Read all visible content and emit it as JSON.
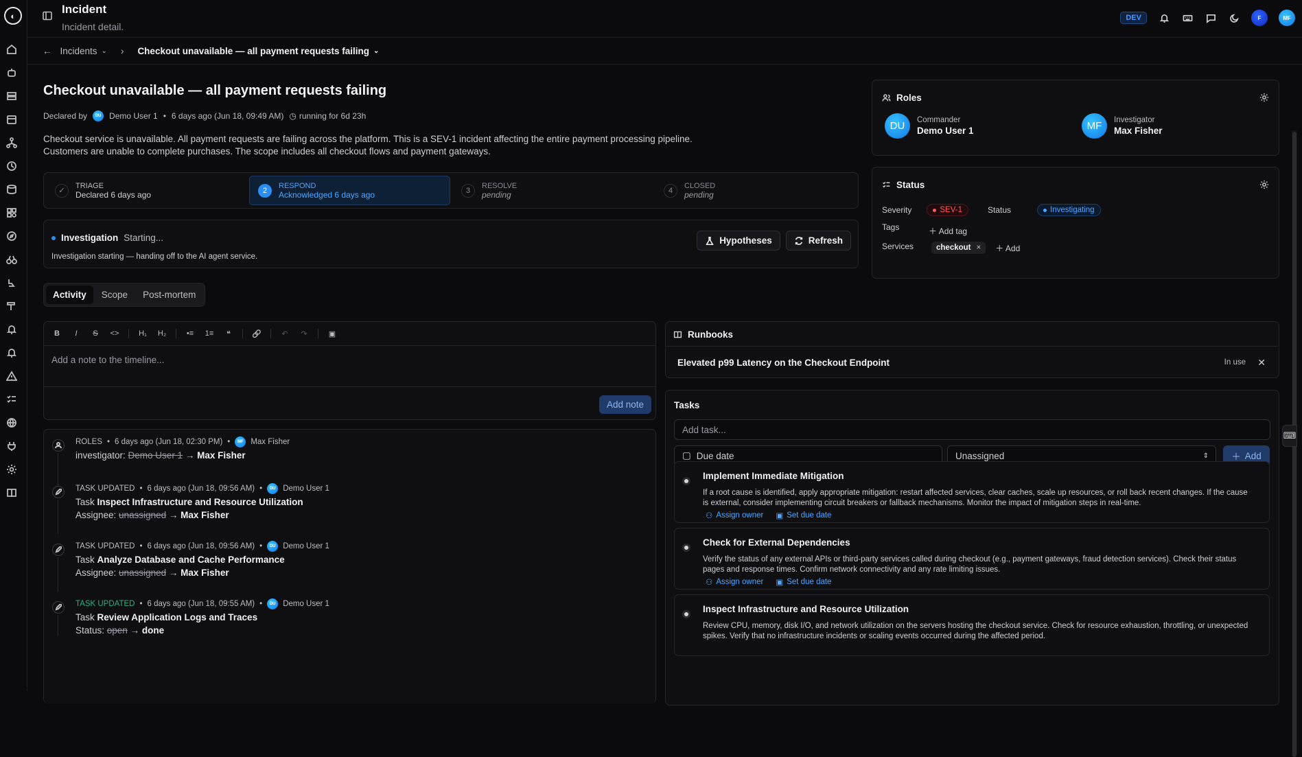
{
  "header": {
    "title": "Incident",
    "subtitle": "Incident detail.",
    "env_badge": "DEV",
    "avatar1": "F",
    "avatar2": "MF"
  },
  "breadcrumb": {
    "parent": "Incidents",
    "current": "Checkout unavailable — all payment requests failing"
  },
  "incident": {
    "title": "Checkout unavailable — all payment requests failing",
    "declared_by_label": "Declared by",
    "declared_by_initials": "DU",
    "declared_by_name": "Demo User 1",
    "declared_when": "6 days ago (Jun 18, 09:49 AM)",
    "running_for": "running for 6d 23h",
    "description": "Checkout service is unavailable. All payment requests are failing across the platform. This is a SEV-1 incident affecting the entire payment processing pipeline. Customers are unable to complete purchases. The scope includes all checkout flows and payment gateways."
  },
  "stages": [
    {
      "num": "✓",
      "name": "TRIAGE",
      "detail": "Declared 6 days ago",
      "state": "done"
    },
    {
      "num": "2",
      "name": "RESPOND",
      "detail": "Acknowledged 6 days ago",
      "state": "active"
    },
    {
      "num": "3",
      "name": "RESOLVE",
      "detail": "pending",
      "state": "pending"
    },
    {
      "num": "4",
      "name": "CLOSED",
      "detail": "pending",
      "state": "pending"
    }
  ],
  "investigation": {
    "label": "Investigation",
    "state": "Starting...",
    "message": "Investigation starting — handing off to the AI agent service.",
    "hypotheses_btn": "Hypotheses",
    "refresh_btn": "Refresh"
  },
  "tabs": [
    "Activity",
    "Scope",
    "Post-mortem"
  ],
  "editor": {
    "placeholder": "Add a note to the timeline...",
    "submit": "Add note",
    "toolbar": [
      "B",
      "I",
      "S",
      "<>",
      "H₁",
      "H₂",
      "•≡",
      "1≡",
      "❝",
      "🔗",
      "↶",
      "↷",
      "▣"
    ]
  },
  "timeline": [
    {
      "kind": "ROLES",
      "when": "6 days ago (Jun 18, 02:30 PM)",
      "actor_initials": "MF",
      "actor": "Max Fisher",
      "l1_pre": "investigator: ",
      "l1_old": "Demo User 1",
      "l1_arrow": " → ",
      "l1_new": "Max Fisher",
      "l2": ""
    },
    {
      "kind": "TASK UPDATED",
      "when": "6 days ago (Jun 18, 09:56 AM)",
      "actor_initials": "DU",
      "actor": "Demo User 1",
      "l1_pre": "Task ",
      "l1_task": "Inspect Infrastructure and Resource Utilization",
      "l2_pre": "Assignee: ",
      "l2_old": "unassigned",
      "l2_arrow": " → ",
      "l2_new": "Max Fisher"
    },
    {
      "kind": "TASK UPDATED",
      "when": "6 days ago (Jun 18, 09:56 AM)",
      "actor_initials": "DU",
      "actor": "Demo User 1",
      "l1_pre": "Task ",
      "l1_task": "Analyze Database and Cache Performance",
      "l2_pre": "Assignee: ",
      "l2_old": "unassigned",
      "l2_arrow": " → ",
      "l2_new": "Max Fisher"
    },
    {
      "kind": "TASK UPDATED",
      "when": "6 days ago (Jun 18, 09:55 AM)",
      "actor_initials": "DU",
      "actor": "Demo User 1",
      "l1_pre": "Task ",
      "l1_task": "Review Application Logs and Traces",
      "l2_pre": "Status: ",
      "l2_old": "open",
      "l2_arrow": " → ",
      "l2_new": "done"
    }
  ],
  "roles": {
    "title": "Roles",
    "commander": {
      "role": "Commander",
      "initials": "DU",
      "name": "Demo User 1"
    },
    "investigator": {
      "role": "Investigator",
      "initials": "MF",
      "name": "Max Fisher"
    }
  },
  "status": {
    "title": "Status",
    "severity_label": "Severity",
    "severity": "SEV-1",
    "status_label": "Status",
    "status": "Investigating",
    "tags_label": "Tags",
    "add_tag": "Add tag",
    "services_label": "Services",
    "service": "checkout",
    "add_service": "Add"
  },
  "runbooks": {
    "title": "Runbooks",
    "item": "Elevated p99 Latency on the Checkout Endpoint",
    "state": "In use"
  },
  "tasks": {
    "title": "Tasks",
    "add_placeholder": "Add task...",
    "due_placeholder": "Due date",
    "assignee": "Unassigned",
    "add_btn": "Add",
    "assign_owner": "Assign owner",
    "set_due": "Set due date",
    "items": [
      {
        "name": "Implement Immediate Mitigation",
        "desc": "If a root cause is identified, apply appropriate mitigation: restart affected services, clear caches, scale up resources, or roll back recent changes. If the cause is external, consider implementing circuit breakers or fallback mechanisms. Monitor the impact of mitigation steps in real-time."
      },
      {
        "name": "Check for External Dependencies",
        "desc": "Verify the status of any external APIs or third-party services called during checkout (e.g., payment gateways, fraud detection services). Check their status pages and response times. Confirm network connectivity and any rate limiting issues."
      },
      {
        "name": "Inspect Infrastructure and Resource Utilization",
        "desc": "Review CPU, memory, disk I/O, and network utilization on the servers hosting the checkout service. Check for resource exhaustion, throttling, or unexpected spikes. Verify that no infrastructure incidents or scaling events occurred during the affected period."
      }
    ]
  }
}
